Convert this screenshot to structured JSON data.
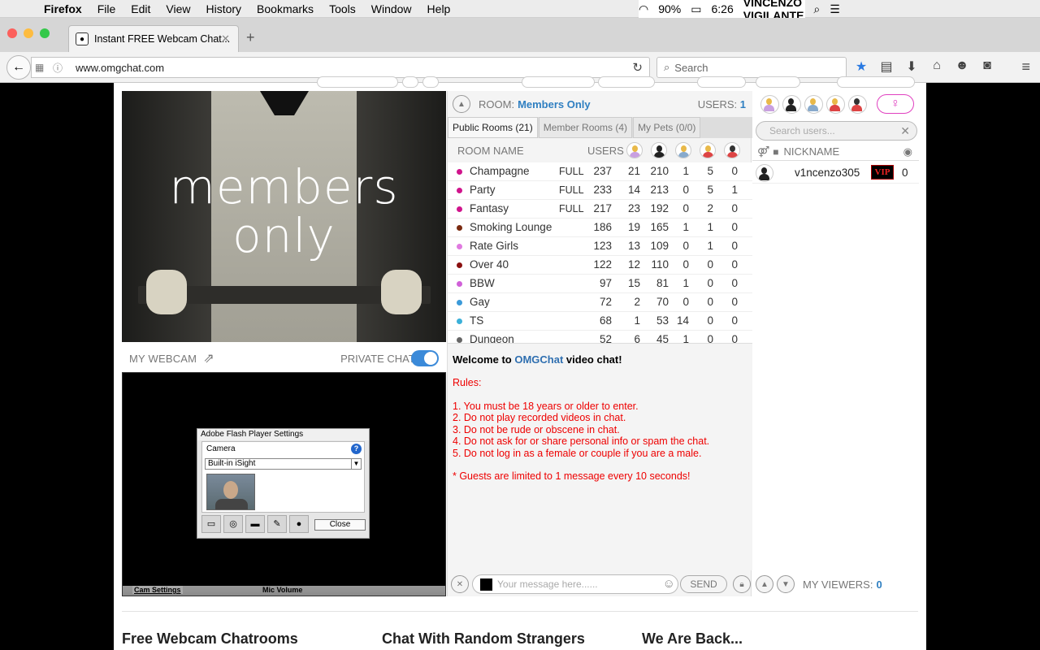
{
  "mac_menu": {
    "app": "Firefox",
    "items": [
      "File",
      "Edit",
      "View",
      "History",
      "Bookmarks",
      "Tools",
      "Window",
      "Help"
    ],
    "battery": "90%",
    "clock": "Tue 6:26 PM",
    "user": "VINCENZO VIGILANTE"
  },
  "browser": {
    "tab_title": "Instant FREE Webcam Chat...",
    "url": "www.omgchat.com",
    "search_placeholder": "Search"
  },
  "banner": {
    "line1": "members",
    "line2": "only"
  },
  "webcam": {
    "label": "MY WEBCAM",
    "private_chat_label": "PRIVATE CHAT:",
    "private_chat_on": true,
    "flash": {
      "title": "Adobe Flash Player Settings",
      "section": "Camera",
      "device": "Built-in iSight",
      "close": "Close"
    },
    "footer_left": "Cam Settings",
    "footer_mid": "Mic Volume"
  },
  "room": {
    "label": "ROOM:",
    "name": "Members Only",
    "users_label": "USERS:",
    "users_count": "1",
    "tabs": [
      "Public Rooms (21)",
      "Member Rooms (4)",
      "My Pets (0/0)"
    ],
    "col_room_name": "ROOM NAME",
    "col_users": "USERS",
    "rows": [
      {
        "name": "Champagne",
        "full": "FULL",
        "users": "237",
        "a": "21",
        "b": "210",
        "c": "1",
        "d": "5",
        "e": "0",
        "color": "#d0148c"
      },
      {
        "name": "Party",
        "full": "FULL",
        "users": "233",
        "a": "14",
        "b": "213",
        "c": "0",
        "d": "5",
        "e": "1",
        "color": "#d0148c"
      },
      {
        "name": "Fantasy",
        "full": "FULL",
        "users": "217",
        "a": "23",
        "b": "192",
        "c": "0",
        "d": "2",
        "e": "0",
        "color": "#d0148c"
      },
      {
        "name": "Smoking Lounge",
        "full": "",
        "users": "186",
        "a": "19",
        "b": "165",
        "c": "1",
        "d": "1",
        "e": "0",
        "color": "#7a2a10"
      },
      {
        "name": "Rate Girls",
        "full": "",
        "users": "123",
        "a": "13",
        "b": "109",
        "c": "0",
        "d": "1",
        "e": "0",
        "color": "#e07ae0"
      },
      {
        "name": "Over 40",
        "full": "",
        "users": "122",
        "a": "12",
        "b": "110",
        "c": "0",
        "d": "0",
        "e": "0",
        "color": "#8a1010"
      },
      {
        "name": "BBW",
        "full": "",
        "users": "97",
        "a": "15",
        "b": "81",
        "c": "1",
        "d": "0",
        "e": "0",
        "color": "#d060d8"
      },
      {
        "name": "Gay",
        "full": "",
        "users": "72",
        "a": "2",
        "b": "70",
        "c": "0",
        "d": "0",
        "e": "0",
        "color": "#3b9ad9"
      },
      {
        "name": "TS",
        "full": "",
        "users": "68",
        "a": "1",
        "b": "53",
        "c": "14",
        "d": "0",
        "e": "0",
        "color": "#3bb0d9"
      },
      {
        "name": "Dungeon",
        "full": "",
        "users": "52",
        "a": "6",
        "b": "45",
        "c": "1",
        "d": "0",
        "e": "0",
        "color": "#666666"
      }
    ]
  },
  "chat": {
    "welcome_prefix": "Welcome to ",
    "welcome_brand": "OMGChat",
    "welcome_suffix": " video chat!",
    "rules_title": "Rules:",
    "rules": [
      "1. You must be 18 years or older to enter.",
      "2. Do not play recorded videos in chat.",
      "3. Do not be rude or obscene in chat.",
      "4. Do not ask for or share personal info or spam the chat.",
      "5. Do not log in as a female or couple if you are a male."
    ],
    "guest_note": "* Guests are limited to 1 message every 10 seconds!",
    "input_placeholder": "Your message here......",
    "send": "SEND"
  },
  "users_panel": {
    "search_placeholder": "Search users...",
    "col_nickname": "NICKNAME",
    "user": {
      "name": "v1ncenzo305",
      "badge": "VIP",
      "count": "0"
    },
    "viewers_label": "MY VIEWERS:",
    "viewers_count": "0"
  },
  "footer": {
    "h1": "Free Webcam Chatrooms",
    "h2": "Chat With Random Strangers",
    "h3": "We Are Back..."
  }
}
